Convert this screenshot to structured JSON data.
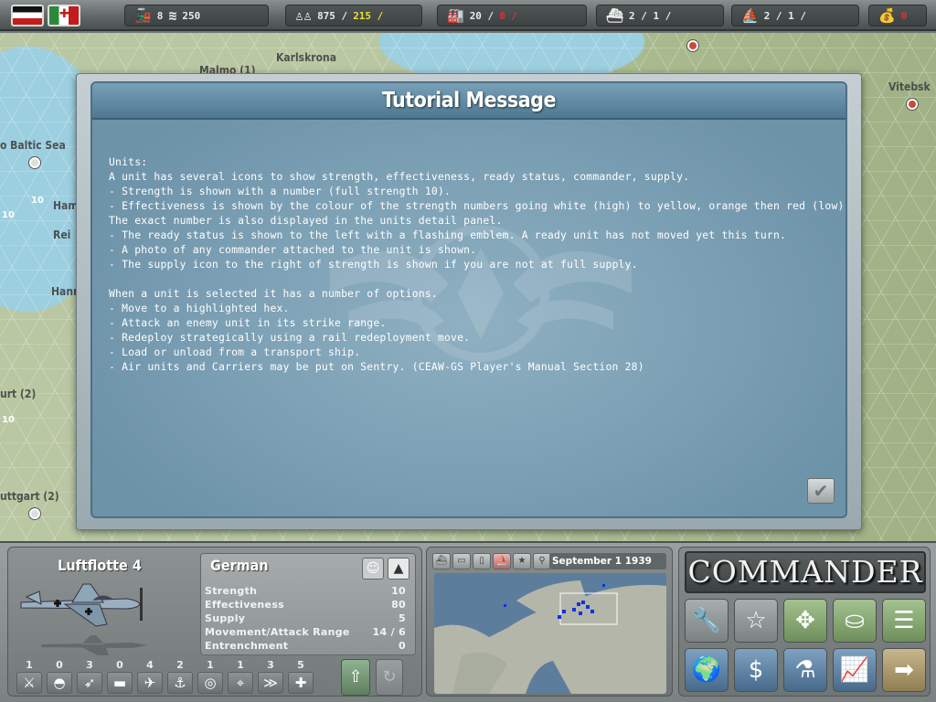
{
  "topbar": {
    "rail_count": "8",
    "coins": "250",
    "manpower": "875 /",
    "manpower_income": "215 /",
    "industry": "20 /",
    "industry_red": "0 /",
    "naval_transport": "2 /  1 /",
    "amphib_transport": "2 /  1 /",
    "gold": "0"
  },
  "map": {
    "labels": [
      "Malmo (1)",
      "Karlskrona",
      "o Baltic Sea",
      "Vitebsk",
      "Ham",
      "Rei",
      "Hann",
      "urt (2)",
      "uttgart (2)"
    ],
    "unit_strengths": [
      "10",
      "10",
      "10"
    ]
  },
  "dialog": {
    "title": "Tutorial Message",
    "body": "Units:\nA unit has several icons to show strength, effectiveness, ready status, commander, supply.\n- Strength is shown with a number (full strength 10).\n- Effectiveness is shown by the colour of the strength numbers going white (high) to yellow, orange then red (low).\nThe exact number is also displayed in the units detail panel.\n- The ready status is shown to the left with a flashing emblem. A ready unit has not moved yet this turn.\n- A photo of any commander attached to the unit is shown.\n- The supply icon to the right of strength is shown if you are not at full supply.\n\nWhen a unit is selected it has a number of options.\n- Move to a highlighted hex.\n- Attack an enemy unit in its strike range.\n- Redeploy strategically using a rail redeployment move.\n- Load or unload from a transport ship.\n- Air units and Carriers may be put on Sentry. (CEAW-GS Player's Manual Section 28)"
  },
  "unit": {
    "name": "Luftflotte 4",
    "nation": "German",
    "stats": [
      {
        "label": "Strength",
        "value": "10"
      },
      {
        "label": "Effectiveness",
        "value": "80"
      },
      {
        "label": "Supply",
        "value": "5"
      },
      {
        "label": "Movement/Attack Range",
        "value": "14 / 6"
      },
      {
        "label": "Entrenchment",
        "value": "0"
      }
    ],
    "tech_levels": [
      "1",
      "0",
      "3",
      "0",
      "4",
      "2",
      "1",
      "1",
      "3",
      "5"
    ],
    "tech_icons": [
      "rifle-icon",
      "helmet-icon",
      "artillery-icon",
      "tank-icon",
      "plane-icon",
      "anchor-icon",
      "radar-icon",
      "target-icon",
      "rank-icon",
      "medic-icon"
    ]
  },
  "minimap": {
    "date": "September 1 1939 (1)"
  },
  "commander": {
    "logo": "COMMANDER"
  }
}
